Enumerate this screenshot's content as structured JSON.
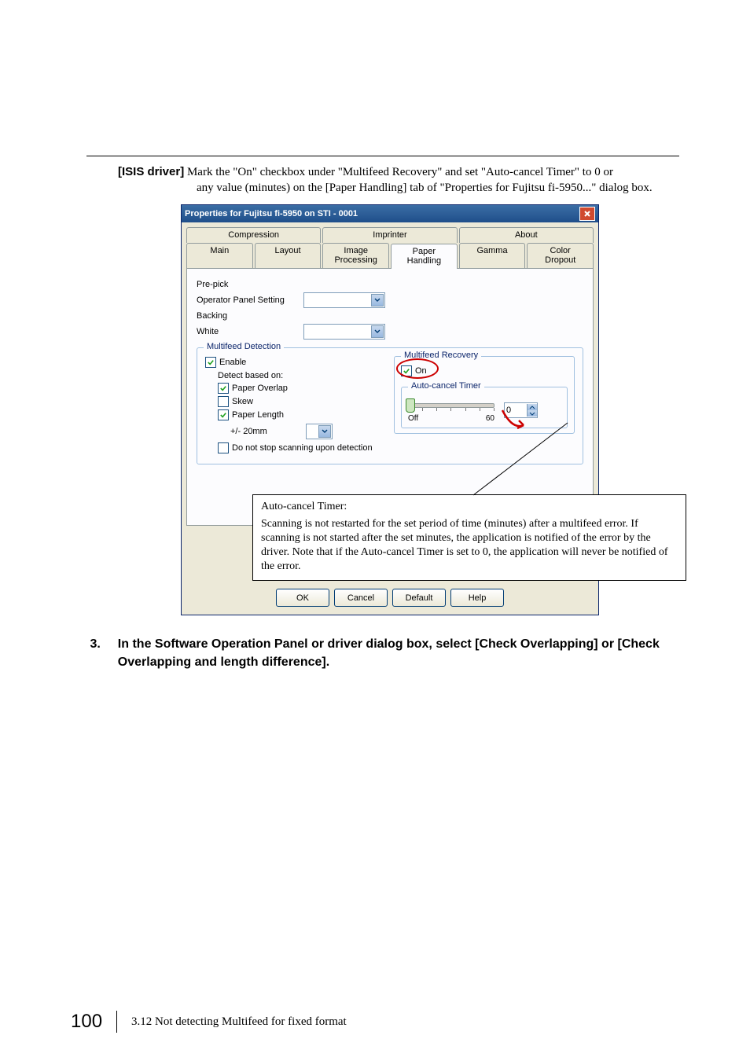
{
  "domain": "Document",
  "paragraph": {
    "lead_bold": "[ISIS driver]",
    "line1": " Mark the \"On\" checkbox under \"Multifeed Recovery\" and set \"Auto-cancel Timer\" to 0 or",
    "line2": "any value (minutes) on the [Paper Handling] tab of \"Properties for Fujitsu fi-5950...\" dialog box."
  },
  "dialog": {
    "title": "Properties for Fujitsu fi-5950 on STI - 0001",
    "tabs_back": [
      "Compression",
      "Imprinter",
      "About"
    ],
    "tabs_front": [
      "Main",
      "Layout",
      "Image Processing",
      "Paper Handling",
      "Gamma",
      "Color Dropout"
    ],
    "active_tab": "Paper Handling",
    "prepick_label": "Pre-pick",
    "operator_panel_label": "Operator Panel Setting",
    "backing_label": "Backing",
    "backing_value": "White",
    "mf_group": "Multifeed Detection",
    "enable_label": "Enable",
    "detect_based_on": "Detect based on:",
    "paper_overlap": "Paper Overlap",
    "skew": "Skew",
    "paper_length": "Paper Length",
    "pl_value": "+/- 20mm",
    "no_stop": "Do not stop scanning upon detection",
    "recovery_group": "Multifeed Recovery",
    "on_label": "On",
    "timer_group": "Auto-cancel Timer",
    "slider_off": "Off",
    "slider_max": "60",
    "timer_value": "0",
    "buttons": [
      "OK",
      "Cancel",
      "Default",
      "Help"
    ]
  },
  "callout": {
    "title": "Auto-cancel Timer:",
    "body": "Scanning is not restarted for the set period of time (minutes) after a multifeed error. If scanning is not started after the set minutes, the application is notified of the error by the driver. Note that if the Auto-cancel Timer is set to 0, the application will never be notified of the error."
  },
  "step": {
    "num": "3.",
    "text": "In the Software Operation Panel or driver dialog box, select [Check Overlapping] or [Check Overlapping and length difference]."
  },
  "footer": {
    "page": "100",
    "section": "3.12 Not detecting Multifeed for fixed format"
  }
}
